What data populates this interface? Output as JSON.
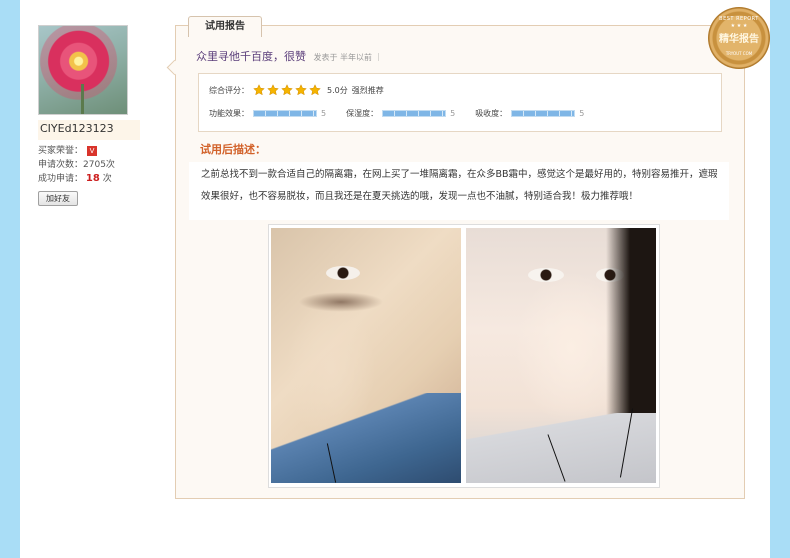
{
  "user": {
    "username": "CIYEd123123",
    "honor_label": "买家荣誉：",
    "honor_badge": "V",
    "apply_count_label": "申请次数：",
    "apply_count": "2705次",
    "success_label": "成功申请：",
    "success_count": "18",
    "success_unit": "次",
    "add_friend": "加好友"
  },
  "report": {
    "tab_label": "试用报告",
    "title": "众里寻他千百度，很赞",
    "meta": "发表于 半年以前 ｜",
    "rating": {
      "overall_label": "综合评分：",
      "stars": 5,
      "score": "5.0分",
      "recommend": "强烈推荐",
      "metrics": [
        {
          "label": "功能效果：",
          "value": "5",
          "fraction": 1.0
        },
        {
          "label": "保湿度：",
          "value": "5",
          "fraction": 1.0
        },
        {
          "label": "吸收度：",
          "value": "5",
          "fraction": 1.0
        }
      ]
    },
    "description_heading": "试用后描述：",
    "description": "之前总找不到一款合适自己的隔离霜，在网上买了一堆隔离霜，在众多BB霜中，感觉这个是最好用的，特别容易推开，遮瑕效果很好，也不容易脱妆，而且我还是在夏天挑选的哦，发现一点也不油腻，特别适合我！极力推荐哦！"
  },
  "seal": {
    "top_text": "BEST REPORT",
    "main_text": "精华报告",
    "bottom_text": "TRYOUT COM"
  },
  "colors": {
    "accent_orange": "#d2622a",
    "title_purple": "#5a3d7a",
    "star_gold": "#f5b400",
    "bar_blue": "#7fb6e6"
  }
}
